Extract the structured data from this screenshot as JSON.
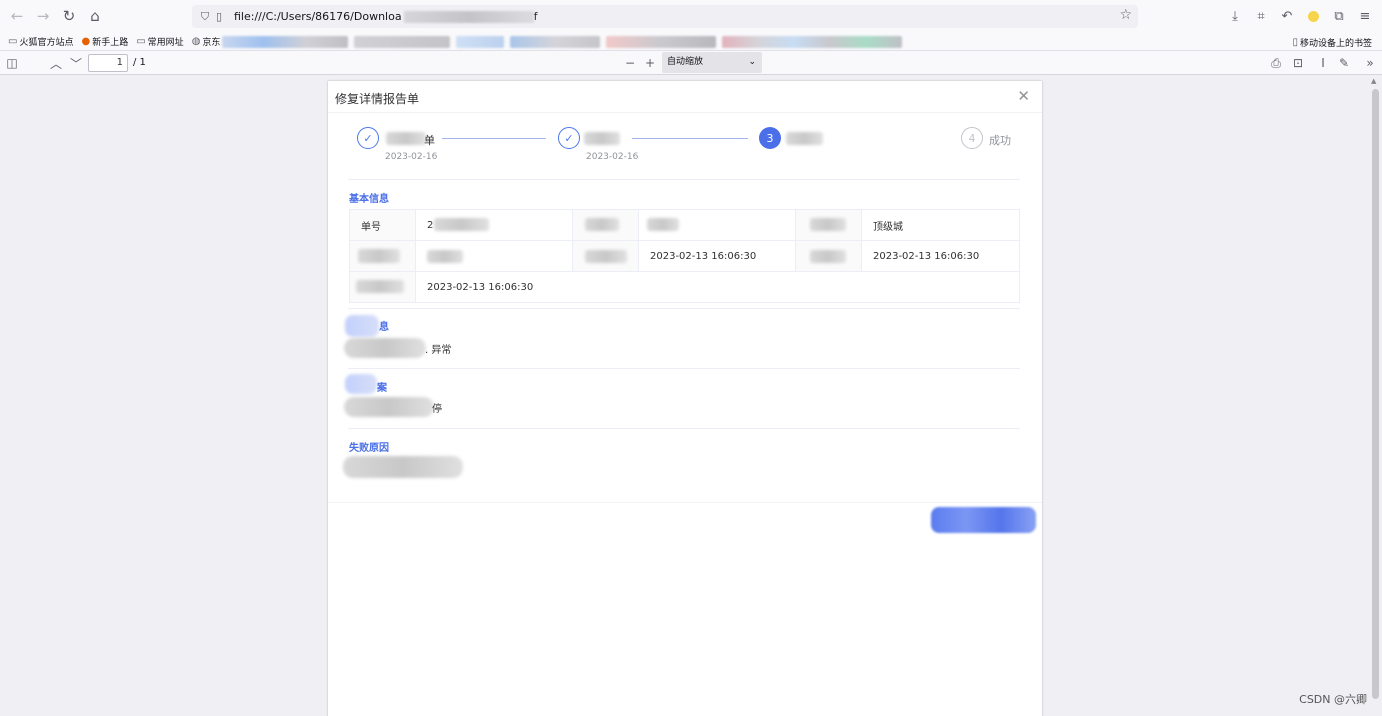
{
  "browser": {
    "url": "file:///C:/Users/86176/Downloa",
    "url_tail": "f",
    "bookmarks": [
      {
        "label": "火狐官方站点"
      },
      {
        "label": "新手上路"
      },
      {
        "label": "常用网址"
      },
      {
        "label": "京东"
      }
    ],
    "mobile_bookmarks": "移动设备上的书签"
  },
  "pdf_toolbar": {
    "page_number": "1",
    "page_total": "/ 1",
    "zoom_label": "自动缩放"
  },
  "dialog": {
    "title": "修复详情报告单",
    "close_glyph": "✕",
    "steps": [
      {
        "index": "✓",
        "title_tail": "单",
        "date": "2023-02-16",
        "status": "done"
      },
      {
        "index": "✓",
        "title_tail": "",
        "date": "2023-02-16",
        "status": "done"
      },
      {
        "index": "3",
        "title_tail": "",
        "date": "",
        "status": "active"
      },
      {
        "index": "4",
        "title_tail": "成功",
        "date": "",
        "status": "wait"
      }
    ],
    "basic_info": {
      "title": "基本信息",
      "order_no_label": "单号",
      "order_no_value": "2",
      "level_value": "顶级城",
      "time_1": "2023-02-13 16:06:30",
      "time_2": "2023-02-13 16:06:30",
      "time_3": "2023-02-13 16:06:30"
    },
    "section_2": {
      "title_tail": "息",
      "text_tail": ". 异常"
    },
    "section_3": {
      "title_tail": "案",
      "text_tail": "停"
    },
    "failure": {
      "title": "失败原因"
    }
  },
  "watermark": "CSDN @六卿",
  "colors": {
    "accent": "#4a6fe8",
    "step_line": "#a3b6ef",
    "border": "#ebeef5"
  }
}
